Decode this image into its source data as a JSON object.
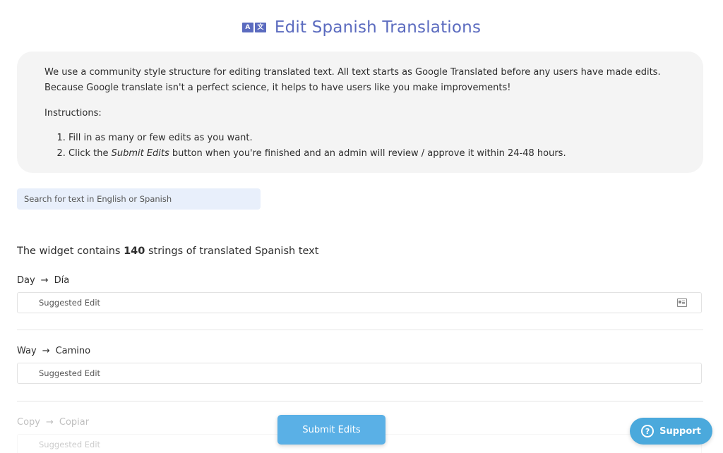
{
  "header": {
    "title": "Edit Spanish Translations",
    "icon_left": "A",
    "icon_right": "文"
  },
  "info": {
    "line1": "We use a community style structure for editing translated text. All text starts as Google Translated before any users have made edits.",
    "line2": "Because Google translate isn't a perfect science, it helps to have users like you make improvements!",
    "instructions_heading": "Instructions:",
    "step1": "Fill in as many or few edits as you want.",
    "step2_before": "Click the ",
    "step2_em": "Submit Edits",
    "step2_after": " button when you're finished and an admin will review / approve it within 24-48 hours."
  },
  "search": {
    "placeholder": "Search for text in English or Spanish"
  },
  "summary": {
    "prefix": "The widget contains ",
    "count": "140",
    "suffix": " strings of translated Spanish text"
  },
  "entries": [
    {
      "english": "Day",
      "arrow": "→",
      "spanish": "Día",
      "placeholder": "Suggested Edit"
    },
    {
      "english": "Way",
      "arrow": "→",
      "spanish": "Camino",
      "placeholder": "Suggested Edit"
    },
    {
      "english": "Copy",
      "arrow": "→",
      "spanish": "Copiar",
      "placeholder": "Suggested Edit"
    }
  ],
  "submit": {
    "label": "Submit Edits"
  },
  "support": {
    "label": "Support",
    "icon": "?"
  }
}
